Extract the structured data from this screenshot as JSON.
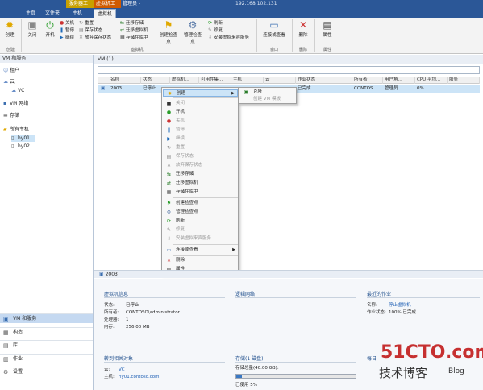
{
  "titlebar": {
    "context_tab_server": "服务器工具",
    "context_tab_vm": "虚拟机工具",
    "app_title": "管理员 -",
    "host": "192.168.102.131"
  },
  "ribbon_tabs": [
    "主页",
    "文件夹",
    "主机",
    "虚拟机"
  ],
  "ribbon": {
    "create": "创建",
    "shutdown": "关闭",
    "start": "开机",
    "stop": "关机",
    "pause": "暂停",
    "resume": "继续",
    "reset": "重置",
    "save_state": "保存状态",
    "discard_saved": "放弃保存状态",
    "migrate_storage": "迁移存储",
    "migrate_vm": "迁移虚拟机",
    "store_library": "存储在库中",
    "create_checkpoint": "创建检查点",
    "manage_checkpoint": "管理检查点",
    "refresh": "刷新",
    "repair": "修复",
    "install_integration": "安装虚拟来宾服务",
    "connect_viewer": "连接或查看",
    "delete": "删除",
    "properties": "属性",
    "group_create": "创建",
    "group_vm": "虚拟机",
    "group_window": "窗口",
    "group_delete": "删除",
    "group_properties": "属性"
  },
  "leftnav": {
    "header": "VM 和服务",
    "tree": {
      "tenants": "租户",
      "clouds": "云",
      "vc": "VC",
      "vm_networks": "VM 网络",
      "storage": "存储",
      "all_hosts": "所有主机",
      "hy01": "hy01",
      "hy02": "hy02"
    },
    "nav_buttons": [
      "VM 和服务",
      "构造",
      "库",
      "作业",
      "设置"
    ]
  },
  "main": {
    "header": "VM (1)",
    "columns": [
      "名称",
      "状态",
      "虚拟机...",
      "可用性集...",
      "主机",
      "云",
      "作业状态",
      "所有者",
      "用户角...",
      "CPU 平均...",
      "服务"
    ],
    "row": {
      "name": "2003",
      "status": "已停止",
      "host": "hy01",
      "job_status": "已完成",
      "owner": "CONTOS...",
      "user_role": "管理员",
      "cpu": "0%"
    }
  },
  "context_menu": {
    "items": [
      {
        "label": "创建",
        "disabled": false,
        "submenu": true
      },
      {
        "label": "关闭",
        "disabled": true
      },
      {
        "label": "开机",
        "disabled": false
      },
      {
        "label": "关机",
        "disabled": true
      },
      {
        "label": "暂停",
        "disabled": true
      },
      {
        "label": "继续",
        "disabled": true
      },
      {
        "label": "重置",
        "disabled": true
      },
      {
        "label": "保存状态",
        "disabled": true
      },
      {
        "label": "放弃保存状态",
        "disabled": true
      },
      {
        "label": "迁移存储",
        "disabled": false
      },
      {
        "label": "迁移虚拟机",
        "disabled": false
      },
      {
        "label": "存储在库中",
        "disabled": false
      },
      {
        "label": "创建检查点",
        "disabled": false
      },
      {
        "label": "管理检查点",
        "disabled": false
      },
      {
        "label": "刷新",
        "disabled": false
      },
      {
        "label": "修复",
        "disabled": true
      },
      {
        "label": "安装虚拟来宾服务",
        "disabled": true
      },
      {
        "label": "连接或查看",
        "disabled": false,
        "submenu": true
      },
      {
        "label": "删除",
        "disabled": false
      },
      {
        "label": "属性",
        "disabled": false
      }
    ],
    "submenu": [
      "克隆",
      "创建 VM 模板"
    ]
  },
  "details": {
    "selected": "2003",
    "vm_info_title": "虚拟机信息",
    "status_k": "状态:",
    "status_v": "已停止",
    "owner_k": "所有者:",
    "owner_v": "CONTOSO\\administrator",
    "cpu_k": "处理器:",
    "cpu_v": "1",
    "mem_k": "内存:",
    "mem_v": "256.00 MB",
    "logical_network_title": "逻辑网络",
    "recent_job_title": "最近的作业",
    "job_name_k": "名称:",
    "job_name_v": "停止虚拟机",
    "job_status_k": "作业状态:",
    "job_status_v": "100% 已完成",
    "related_title": "转到相关对象",
    "cloud_k": "云:",
    "cloud_v": "VC",
    "host_k": "主机:",
    "host_v": "hy01.contoso.com",
    "storage_title": "存储(1 磁盘)",
    "storage_total": "存储总量(40.00 GB):",
    "storage_used": "已使用 5%",
    "storage_used_fraction": 0.05,
    "more_title": "每日"
  },
  "watermark": {
    "line1": "51CTO.com",
    "line2": "技术博客",
    "line3": "Blog"
  },
  "colors": {
    "titlebar": "#2b5797",
    "accent_yellow": "#c8a000",
    "accent_orange": "#d05a00",
    "selection": "#cce4f7",
    "link": "#1e5fb4"
  }
}
